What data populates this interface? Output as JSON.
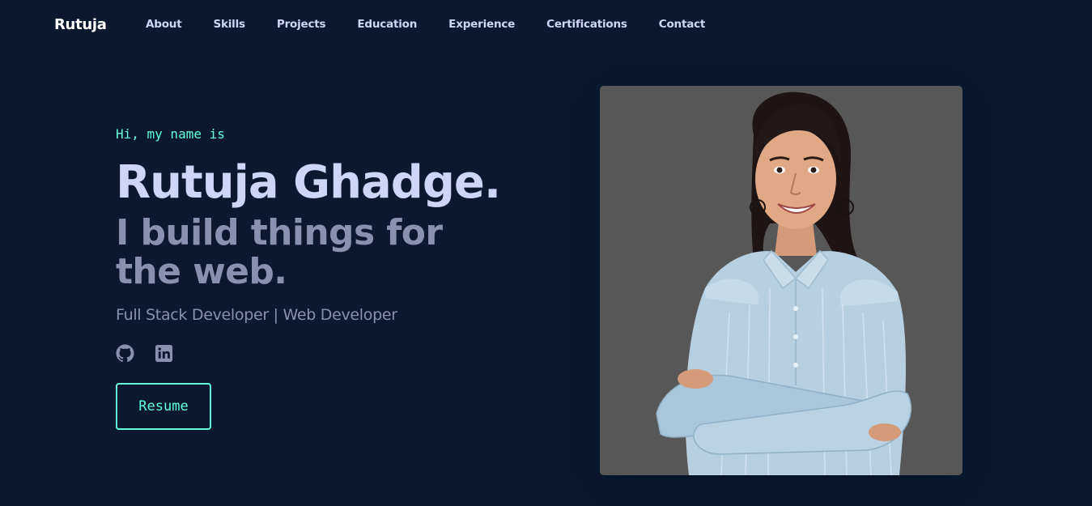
{
  "nav": {
    "brand": "Rutuja",
    "links": [
      {
        "label": "About"
      },
      {
        "label": "Skills"
      },
      {
        "label": "Projects"
      },
      {
        "label": "Education"
      },
      {
        "label": "Experience"
      },
      {
        "label": "Certifications"
      },
      {
        "label": "Contact"
      }
    ]
  },
  "hero": {
    "greeting": "Hi, my name is",
    "name": "Rutuja Ghadge.",
    "tagline": "I build things for the web.",
    "role": "Full Stack Developer | Web Developer",
    "socials": [
      {
        "icon": "github-icon"
      },
      {
        "icon": "linkedin-icon"
      }
    ],
    "resume_label": "Resume"
  },
  "photo": {
    "background": "#575757"
  },
  "colors": {
    "background": "#0a192f",
    "accent": "#64ffda",
    "heading": "#ccd6f6",
    "muted": "#8892b0"
  }
}
